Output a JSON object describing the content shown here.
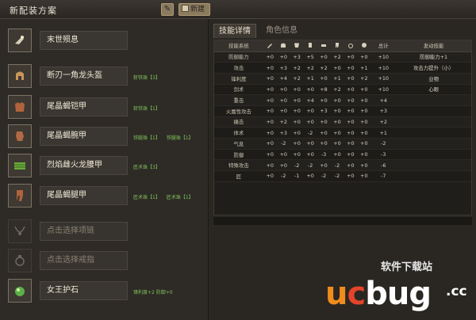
{
  "header": {
    "title": "新配装方案",
    "new_label": "新建"
  },
  "slots": [
    {
      "name": "末世殒息",
      "gems": []
    },
    {
      "name": "断刃一角龙头盔",
      "gems": [
        "斩铁珠【3】"
      ]
    },
    {
      "name": "尾晶蝎铠甲",
      "gems": [
        "斩铁珠【1】"
      ]
    },
    {
      "name": "尾晶蝎腕甲",
      "gems": [
        "铁腿珠【1】",
        "铁腿珠【1】"
      ]
    },
    {
      "name": "烈焰雌火龙腰甲",
      "gems": [
        "匠术珠【3】"
      ]
    },
    {
      "name": "尾晶蝎腿甲",
      "gems": [
        "匠术珠【1】",
        "匠术珠【1】"
      ]
    },
    {
      "name": "点击选择项链",
      "gems": []
    },
    {
      "name": "点击选择戒指",
      "gems": []
    },
    {
      "name": "女王护石",
      "gems": [
        "锋利度+2 防御+0"
      ]
    }
  ],
  "tabs": [
    "技能详情",
    "角色信息"
  ],
  "table": {
    "headers": [
      "技能系统",
      "",
      "",
      "",
      "",
      "",
      "",
      "",
      "",
      "总计",
      "发动技能"
    ],
    "rows": [
      {
        "skill": "防御能力",
        "vals": [
          "+0",
          "+0",
          "+3",
          "+5",
          "+0",
          "+2",
          "+0",
          "+0"
        ],
        "total": "+10",
        "effect": "防御能力+1"
      },
      {
        "skill": "攻击",
        "vals": [
          "+0",
          "+3",
          "+2",
          "+2",
          "+2",
          "+0",
          "+0",
          "+1"
        ],
        "total": "+10",
        "effect": "攻击力提升（小）"
      },
      {
        "skill": "锋利度",
        "vals": [
          "+0",
          "+4",
          "+2",
          "+1",
          "+0",
          "+1",
          "+0",
          "+2"
        ],
        "total": "+10",
        "effect": "业物"
      },
      {
        "skill": "剑术",
        "vals": [
          "+0",
          "+0",
          "+0",
          "+0",
          "+8",
          "+2",
          "+0",
          "+0"
        ],
        "total": "+10",
        "effect": "心眼"
      },
      {
        "skill": "重击",
        "vals": [
          "+0",
          "+0",
          "+0",
          "+4",
          "+0",
          "+0",
          "+0",
          "+0"
        ],
        "total": "+4",
        "effect": ""
      },
      {
        "skill": "火属性攻击",
        "vals": [
          "+0",
          "+0",
          "+0",
          "+0",
          "+3",
          "+0",
          "+0",
          "+0"
        ],
        "total": "+3",
        "effect": ""
      },
      {
        "skill": "痛击",
        "vals": [
          "+0",
          "+2",
          "+0",
          "+0",
          "+0",
          "+0",
          "+0",
          "+0"
        ],
        "total": "+2",
        "effect": ""
      },
      {
        "skill": "体术",
        "vals": [
          "+0",
          "+3",
          "+0",
          "-2",
          "+0",
          "+0",
          "+0",
          "+0"
        ],
        "total": "+1",
        "effect": ""
      },
      {
        "skill": "气息",
        "vals": [
          "+0",
          "-2",
          "+0",
          "+0",
          "+0",
          "+0",
          "+0",
          "+0"
        ],
        "total": "-2",
        "effect": ""
      },
      {
        "skill": "防御",
        "vals": [
          "+0",
          "+0",
          "+0",
          "+0",
          "-3",
          "+0",
          "+0",
          "+0"
        ],
        "total": "-3",
        "effect": ""
      },
      {
        "skill": "特殊攻击",
        "vals": [
          "+0",
          "+0",
          "-2",
          "-2",
          "+0",
          "-2",
          "+0",
          "+0"
        ],
        "total": "-6",
        "effect": ""
      },
      {
        "skill": "匠",
        "vals": [
          "+0",
          "-2",
          "-1",
          "+0",
          "-2",
          "-2",
          "+0",
          "+0"
        ],
        "total": "-7",
        "effect": ""
      }
    ]
  },
  "watermark": {
    "brand_u": "u",
    "brand_c": "c",
    "brand_rest": "bug",
    "tld": ".cc",
    "tagline": "软件下载站"
  },
  "colors": {
    "gem_text": "#7ec15a",
    "bg": "#2b2824",
    "accent": "#8a7a5e"
  }
}
